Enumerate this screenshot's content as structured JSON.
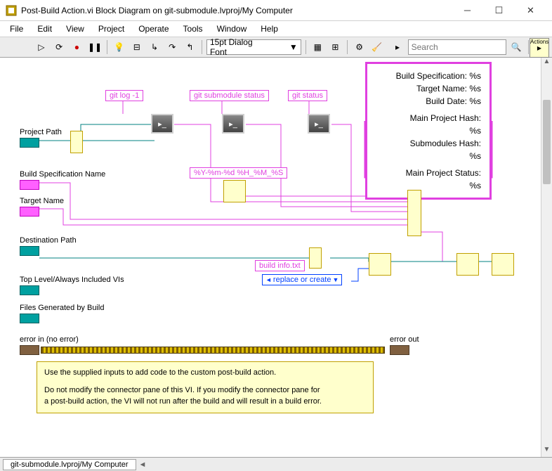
{
  "window": {
    "title": "Post-Build Action.vi Block Diagram on git-submodule.lvproj/My Computer"
  },
  "menu": {
    "file": "File",
    "edit": "Edit",
    "view": "View",
    "project": "Project",
    "operate": "Operate",
    "tools": "Tools",
    "window": "Window",
    "help": "Help"
  },
  "toolbar": {
    "font": "15pt Dialog Font",
    "search_placeholder": "Search"
  },
  "constants": {
    "git_log": "git log -1",
    "git_submod": "git submodule status",
    "git_status": "git status",
    "time_fmt": "%Y-%m-%d %H_%M_%S",
    "build_info": "build info.txt",
    "replace": "replace or create"
  },
  "controls": {
    "proj_path": "Project Path",
    "build_spec": "Build Specification Name",
    "target": "Target Name",
    "dest_path": "Destination Path",
    "top_vis": "Top Level/Always Included VIs",
    "files_gen": "Files Generated by Build",
    "err_in": "error in (no error)",
    "err_out": "error out"
  },
  "format_str": {
    "l1": "Build Specification: %s",
    "l2": "Target Name: %s",
    "l3": "Build Date: %s",
    "l4": "Main Project Hash:",
    "l5": "%s",
    "l6": "Submodules Hash:",
    "l7": "%s",
    "l8": "Main Project Status:",
    "l9": "%s"
  },
  "comment": {
    "l1": "Use the supplied inputs to add code to the custom post-build action.",
    "l2": "Do not modify the connector pane of this VI.  If you modify the connector pane for",
    "l3": "a post-build action, the VI will not run after the build and will result in a build error."
  },
  "status": {
    "tab": "git-submodule.lvproj/My Computer"
  }
}
